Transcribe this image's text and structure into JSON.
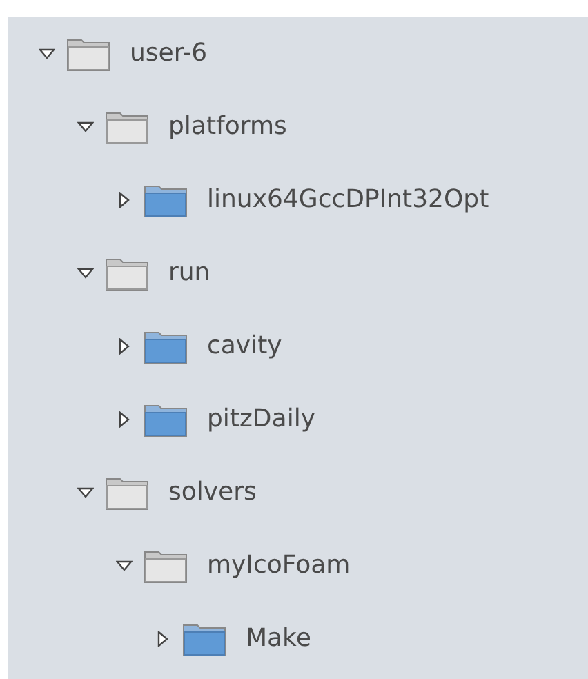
{
  "tree": [
    {
      "label": "user-6",
      "expanded": true,
      "children": [
        {
          "label": "platforms",
          "expanded": true,
          "children": [
            {
              "label": "linux64GccDPInt32Opt",
              "expanded": false
            }
          ]
        },
        {
          "label": "run",
          "expanded": true,
          "children": [
            {
              "label": "cavity",
              "expanded": false
            },
            {
              "label": "pitzDaily",
              "expanded": false
            }
          ]
        },
        {
          "label": "solvers",
          "expanded": true,
          "children": [
            {
              "label": "myIcoFoam",
              "expanded": true,
              "children": [
                {
                  "label": "Make",
                  "expanded": false
                }
              ]
            }
          ]
        }
      ]
    }
  ]
}
